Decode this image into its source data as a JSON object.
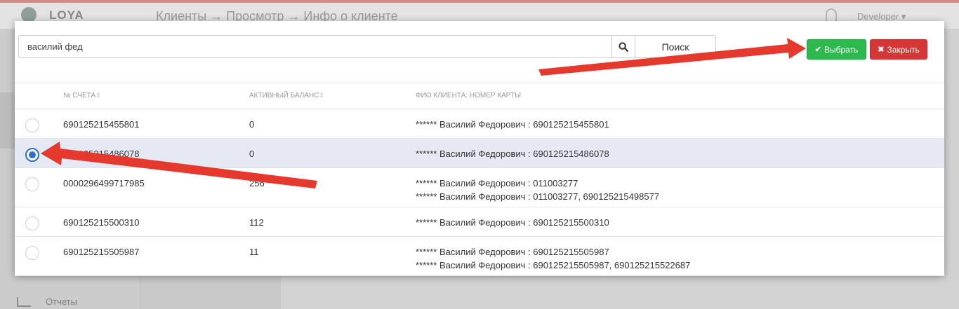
{
  "app": {
    "logo_text": "LOYA",
    "breadcrumb": "Клиенты → Просмотр → Инфо о клиенте",
    "user": "Developer ▾",
    "sidebar_reports": "Отчеты"
  },
  "search": {
    "value": "василий фед",
    "button_label": "Поиск"
  },
  "actions": {
    "select_label": "Выбрать",
    "close_label": "Закрыть"
  },
  "table": {
    "headers": {
      "account": "№ СЧЁТА",
      "balance": "АКТИВНЫЙ БАЛАНС",
      "client": "ФИО КЛИЕНТА: НОМЕР КАРТЫ"
    },
    "rows": [
      {
        "account": "690125215455801",
        "balance": "0",
        "client_lines": [
          "****** Василий Федорович : 690125215455801"
        ],
        "selected": false
      },
      {
        "account": "690125215486078",
        "balance": "0",
        "client_lines": [
          "****** Василий Федорович : 690125215486078"
        ],
        "selected": true
      },
      {
        "account": "0000296499717985",
        "balance": "256",
        "client_lines": [
          "****** Василий Федорович : 011003277",
          "****** Василий Федорович : 011003277, 690125215498577"
        ],
        "selected": false
      },
      {
        "account": "690125215500310",
        "balance": "112",
        "client_lines": [
          "****** Василий Федорович : 690125215500310"
        ],
        "selected": false
      },
      {
        "account": "690125215505987",
        "balance": "11",
        "client_lines": [
          "****** Василий Федорович : 690125215505987",
          "****** Василий Федорович : 690125215505987, 690125215522687"
        ],
        "selected": false
      }
    ]
  },
  "colors": {
    "select_button": "#2db94d",
    "close_button": "#d73636",
    "selected_row": "#e4e9f4",
    "radio_checked": "#2f6ec9",
    "annotation_arrow": "#e5392d"
  },
  "icons": {
    "select": "check-icon",
    "close": "x-icon",
    "search": "search-icon"
  }
}
